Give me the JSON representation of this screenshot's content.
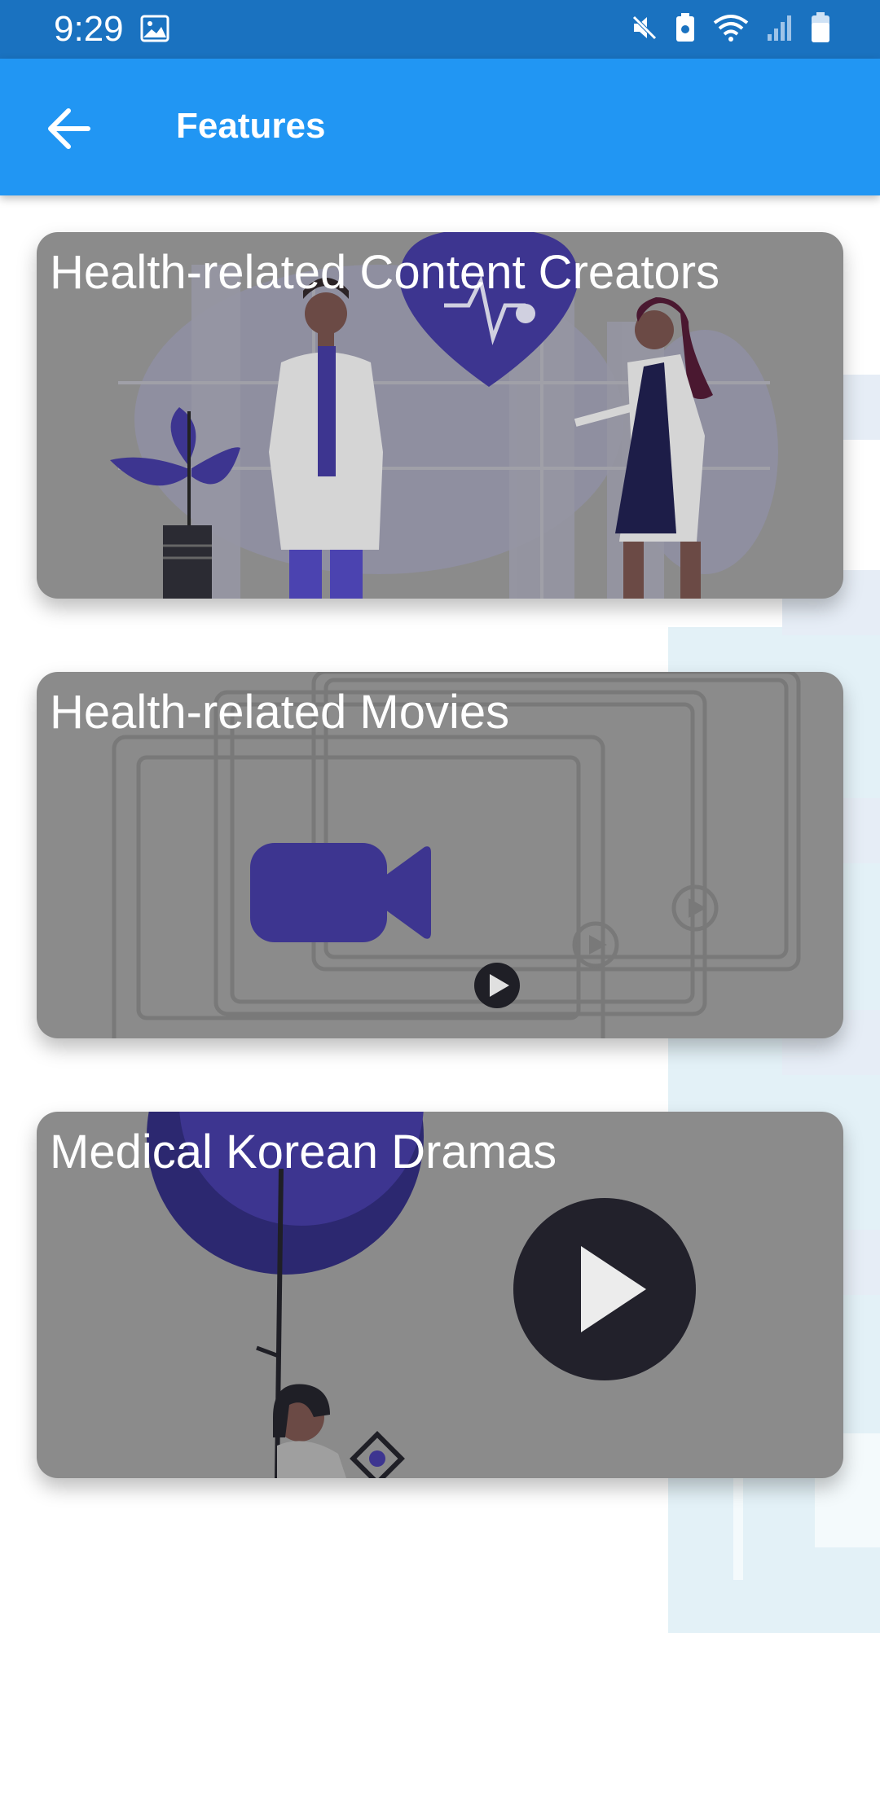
{
  "status_bar": {
    "time": "9:29"
  },
  "app_bar": {
    "title": "Features"
  },
  "features": [
    {
      "label": "Health-related Content Creators",
      "illustration": "doctors-heart-illustration"
    },
    {
      "label": "Health-related Movies",
      "illustration": "video-camera-illustration"
    },
    {
      "label": "Medical Korean Dramas",
      "illustration": "play-button-illustration"
    }
  ],
  "colors": {
    "app_bar": "#2196f3",
    "status_bar": "#1a72c0",
    "card_overlay": "#8b8b8b",
    "accent_purple": "#3d3590"
  }
}
